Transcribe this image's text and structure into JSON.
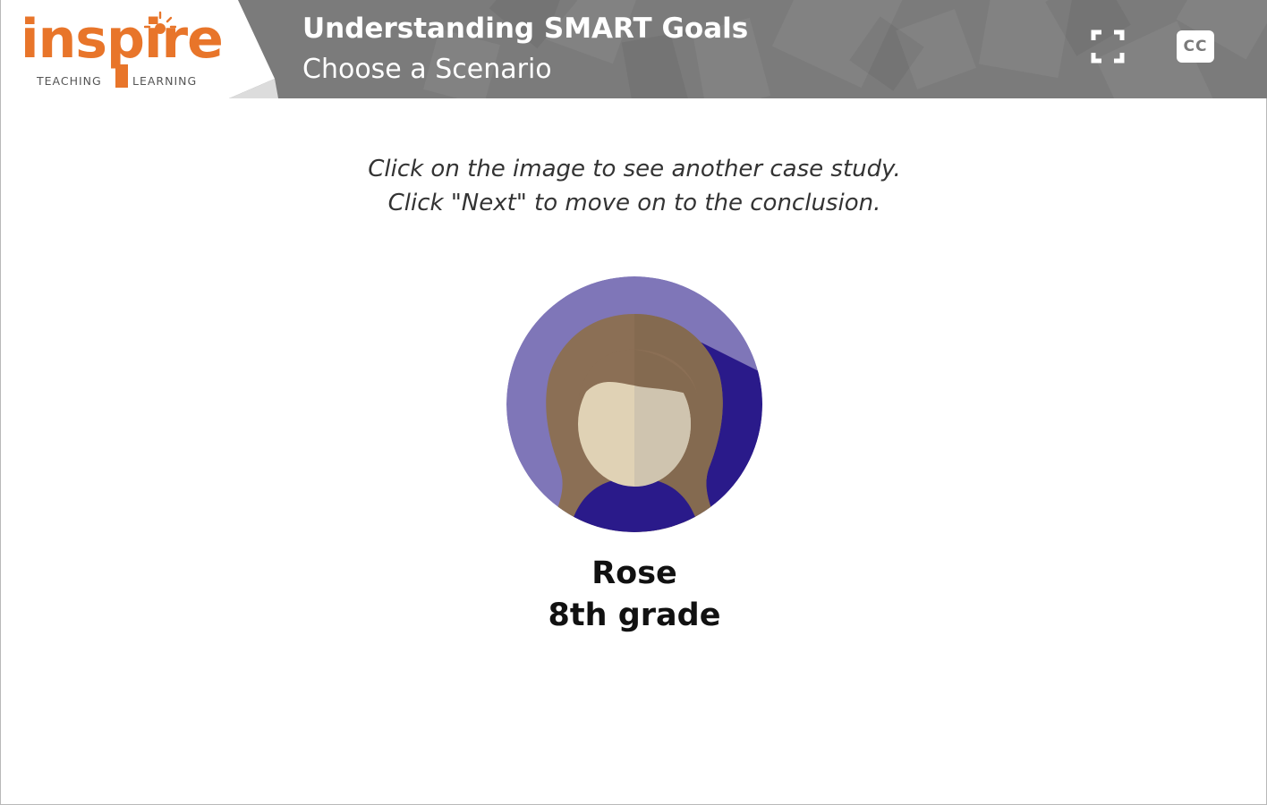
{
  "logo": {
    "word": "inspire",
    "sub_left": "TEACHING",
    "sub_right": "LEARNING"
  },
  "header": {
    "title": "Understanding SMART Goals",
    "subtitle": "Choose a Scenario",
    "fullscreen_icon": "fullscreen-icon",
    "cc_label": "CC"
  },
  "content": {
    "instruction_line1": "Click on the image to see another case study.",
    "instruction_line2": "Click \"Next\" to move on to the conclusion.",
    "student_name": "Rose",
    "student_grade": "8th grade"
  },
  "colors": {
    "header_bg": "#7a7a7a",
    "brand_orange": "#e8752a",
    "avatar_bg": "#7f76b8",
    "avatar_shirt": "#2a1a8a",
    "avatar_hair": "#8b6f55",
    "avatar_skin_light": "#e0d2b5",
    "avatar_skin_shade": "#cfc4af"
  }
}
